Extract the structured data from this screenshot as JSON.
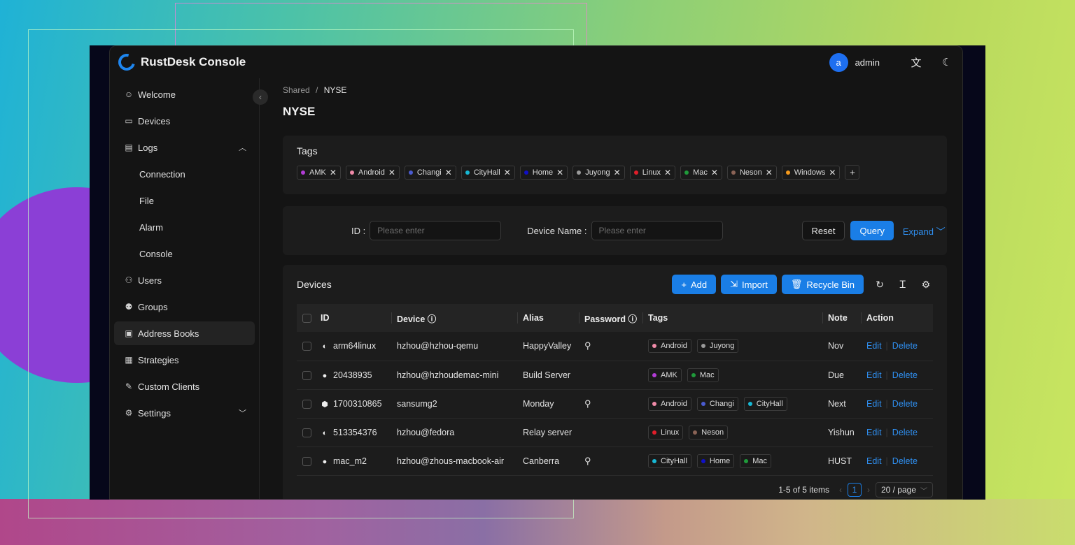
{
  "app": {
    "title": "RustDesk Console",
    "user_initial": "a",
    "username": "admin"
  },
  "sidebar": {
    "items": [
      {
        "label": "Welcome",
        "icon": "smile-icon"
      },
      {
        "label": "Devices",
        "icon": "monitor-icon"
      },
      {
        "label": "Logs",
        "icon": "file-icon"
      },
      {
        "label": "Connection"
      },
      {
        "label": "File"
      },
      {
        "label": "Alarm"
      },
      {
        "label": "Console"
      },
      {
        "label": "Users",
        "icon": "user-icon"
      },
      {
        "label": "Groups",
        "icon": "users-icon"
      },
      {
        "label": "Address Books",
        "icon": "contacts-icon"
      },
      {
        "label": "Strategies",
        "icon": "policy-icon"
      },
      {
        "label": "Custom Clients",
        "icon": "edit-icon"
      },
      {
        "label": "Settings",
        "icon": "gear-icon"
      }
    ]
  },
  "breadcrumb": {
    "parent": "Shared",
    "sep": "/",
    "current": "NYSE"
  },
  "page_title": "NYSE",
  "tags_card": {
    "title": "Tags",
    "tags": [
      {
        "label": "AMK",
        "color": "#b23cd6"
      },
      {
        "label": "Android",
        "color": "#f08aa8"
      },
      {
        "label": "Changi",
        "color": "#4a5bd0"
      },
      {
        "label": "CityHall",
        "color": "#17b8d4"
      },
      {
        "label": "Home",
        "color": "#1010c8"
      },
      {
        "label": "Juyong",
        "color": "#9a9a9a"
      },
      {
        "label": "Linux",
        "color": "#e01e2a"
      },
      {
        "label": "Mac",
        "color": "#1f9a3a"
      },
      {
        "label": "Neson",
        "color": "#8a6356"
      },
      {
        "label": "Windows",
        "color": "#f59a1c"
      }
    ],
    "add_label": "+"
  },
  "filter": {
    "id_label": "ID",
    "id_placeholder": "Please enter",
    "name_label": "Device Name",
    "name_placeholder": "Please enter",
    "reset": "Reset",
    "query": "Query",
    "expand": "Expand"
  },
  "devices": {
    "title": "Devices",
    "add": "Add",
    "import": "Import",
    "recycle": "Recycle Bin",
    "columns": [
      "ID",
      "Device",
      "Alias",
      "Password",
      "Tags",
      "Note",
      "Action"
    ],
    "rows": [
      {
        "os": "circle-logo-icon",
        "id": "arm64linux",
        "device": "hzhou@hzhou-qemu",
        "alias": "HappyValley",
        "password": true,
        "tags": [
          "Android",
          "Juyong"
        ],
        "note": "Nov"
      },
      {
        "os": "apple-icon",
        "id": "20438935",
        "device": "hzhou@hzhoudemac-mini",
        "alias": "Build Server",
        "password": false,
        "tags": [
          "AMK",
          "Mac"
        ],
        "note": "Due"
      },
      {
        "os": "android-icon",
        "id": "1700310865",
        "device": "sansumg2",
        "alias": "Monday",
        "password": true,
        "tags": [
          "Android",
          "Changi",
          "CityHall"
        ],
        "note": "Next"
      },
      {
        "os": "circle-logo-icon",
        "id": "513354376",
        "device": "hzhou@fedora",
        "alias": "Relay server",
        "password": false,
        "tags": [
          "Linux",
          "Neson"
        ],
        "note": "Yishun"
      },
      {
        "os": "apple-icon",
        "id": "mac_m2",
        "device": "hzhou@zhous-macbook-air",
        "alias": "Canberra",
        "password": true,
        "tags": [
          "CityHall",
          "Home",
          "Mac"
        ],
        "note": "HUST"
      }
    ],
    "edit": "Edit",
    "delete": "Delete",
    "total": "1-5 of 5 items",
    "page": "1",
    "page_size": "20 / page"
  }
}
